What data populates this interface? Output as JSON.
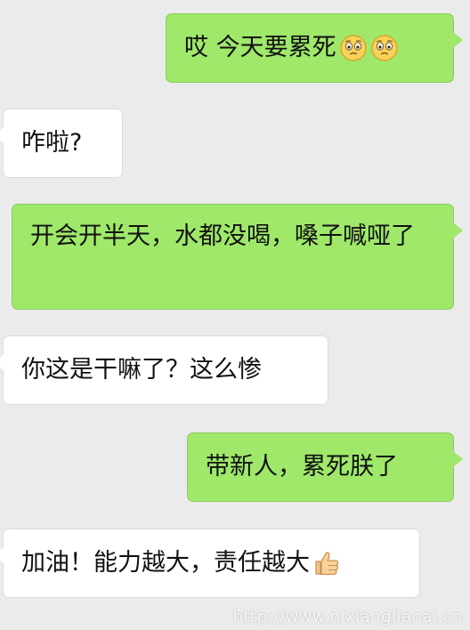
{
  "messages": [
    {
      "side": "out",
      "text": "哎 今天要累死",
      "emojis": [
        "worried-face-icon",
        "worried-face-icon"
      ]
    },
    {
      "side": "in",
      "text": "咋啦?"
    },
    {
      "side": "out",
      "text": "开会开半天，水都没喝，嗓子喊哑了"
    },
    {
      "side": "in",
      "text": "你这是干嘛了？这么惨"
    },
    {
      "side": "out",
      "text": "带新人，累死朕了"
    },
    {
      "side": "in",
      "text": "加油！能力越大，责任越大",
      "emojis": [
        "thumbs-up-icon"
      ]
    }
  ],
  "watermark": "http://www.nixianglianai.cn",
  "colors": {
    "background": "#ebebeb",
    "outgoing_bubble": "#9fe86a",
    "incoming_bubble": "#ffffff"
  }
}
